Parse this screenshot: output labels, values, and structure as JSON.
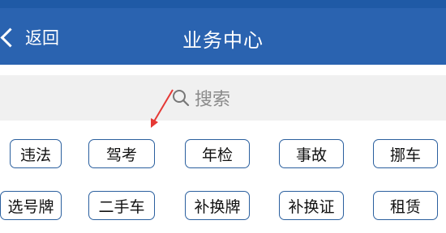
{
  "header": {
    "back_label": "返回",
    "title": "业务中心"
  },
  "search": {
    "placeholder": "搜索"
  },
  "buttons": [
    "违法",
    "驾考",
    "年检",
    "事故",
    "挪车",
    "选号牌",
    "二手车",
    "补换牌",
    "补换证",
    "租赁"
  ],
  "colors": {
    "header_bg": "#2a63b0",
    "button_border": "#2a5f9e",
    "annotation_arrow": "#e53935"
  }
}
